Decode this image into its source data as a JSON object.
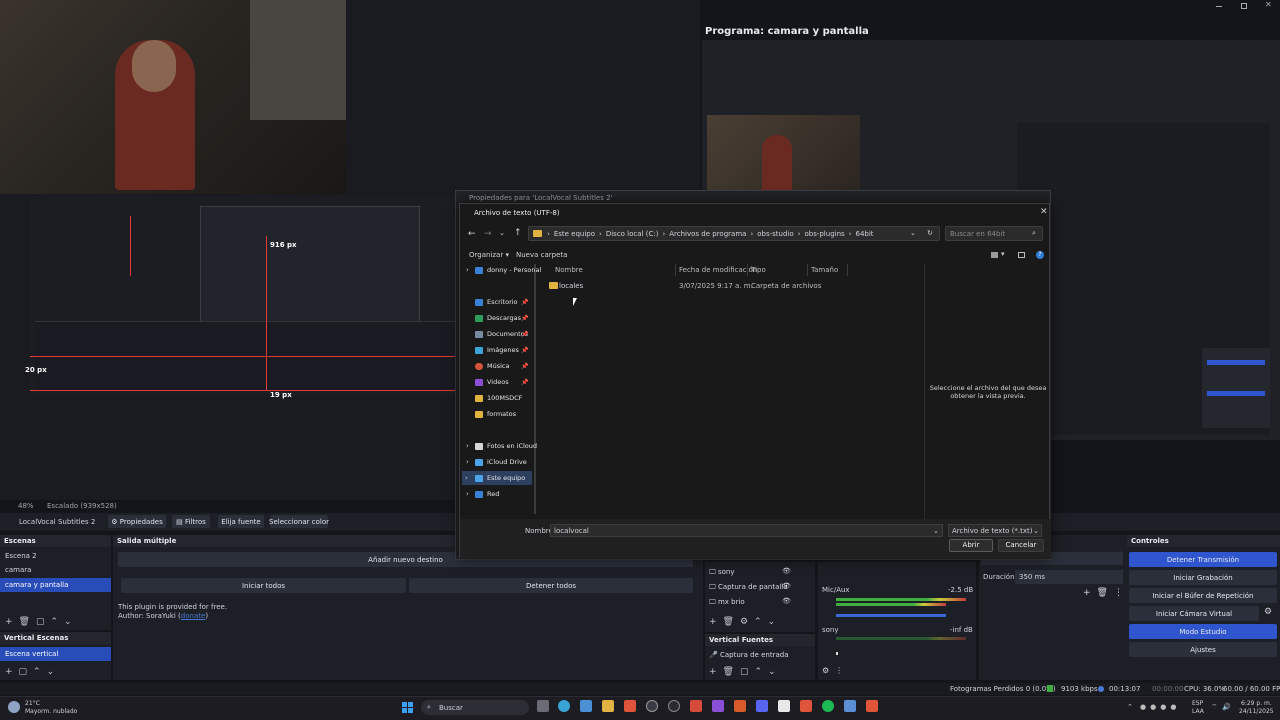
{
  "window": {
    "program_title": "Programa: camara y pantalla",
    "window_controls": [
      "minimize",
      "maximize",
      "close"
    ]
  },
  "preview": {
    "zoom": "48%",
    "scaling": "Escalado (939x528)",
    "measure_labels": [
      "916 px",
      "20 px",
      "19 px"
    ]
  },
  "source_toolbar": {
    "source_name": "LocalVocal Subtitles 2",
    "buttons": [
      "Propiedades",
      "Filtros",
      "Elija fuente",
      "Seleccionar color"
    ]
  },
  "properties_window": {
    "title": "Propiedades para 'LocalVocal Subtitles 2'"
  },
  "file_dialog": {
    "title": "Archivo de texto (UTF-8)",
    "breadcrumb": [
      "Este equipo",
      "Disco local (C:)",
      "Archivos de programa",
      "obs-studio",
      "obs-plugins",
      "64bit"
    ],
    "search_placeholder": "Buscar en 64bit",
    "organize_label": "Organizar",
    "new_folder_label": "Nueva carpeta",
    "columns": [
      "Nombre",
      "Fecha de modificación",
      "Tipo",
      "Tamaño"
    ],
    "files": [
      {
        "name": "locales",
        "modified": "3/07/2025 9:17 a. m.",
        "type": "Carpeta de archivos",
        "size": ""
      }
    ],
    "sidebar": [
      {
        "label": "donny - Personal",
        "icon": "cloud-icon",
        "pinned": false
      },
      {
        "label": "Escritorio",
        "icon": "desktop-icon",
        "pinned": true
      },
      {
        "label": "Descargas",
        "icon": "download-icon",
        "pinned": true
      },
      {
        "label": "Documentos",
        "icon": "document-icon",
        "pinned": true
      },
      {
        "label": "Imágenes",
        "icon": "image-icon",
        "pinned": true
      },
      {
        "label": "Música",
        "icon": "music-icon",
        "pinned": true
      },
      {
        "label": "Videos",
        "icon": "video-icon",
        "pinned": true
      },
      {
        "label": "100MSDCF",
        "icon": "folder-icon",
        "pinned": false
      },
      {
        "label": "formatos",
        "icon": "folder-icon",
        "pinned": false
      },
      {
        "label": "Fotos en iCloud",
        "icon": "photos-icon",
        "pinned": false
      },
      {
        "label": "iCloud Drive",
        "icon": "icloud-icon",
        "pinned": false
      },
      {
        "label": "Este equipo",
        "icon": "pc-icon",
        "pinned": false
      },
      {
        "label": "Red",
        "icon": "network-icon",
        "pinned": false
      }
    ],
    "preview_message": "Seleccione el archivo del que desea obtener la vista previa.",
    "filename_label": "Nombre:",
    "filename_value": "localvocal",
    "filetype_value": "Archivo de texto (*.txt)",
    "open_label": "Abrir",
    "cancel_label": "Cancelar"
  },
  "scenes": {
    "header": "Escenas",
    "items": [
      "Escena 2",
      "camara",
      "camara y pantalla"
    ],
    "selected": 2
  },
  "vertical_scenes": {
    "header": "Vertical Escenas",
    "items": [
      "Escena vertical"
    ]
  },
  "multi_output": {
    "header": "Salida múltiple",
    "add_destination": "Añadir nuevo destino",
    "start_all": "Iniciar todos",
    "stop_all": "Detener todos",
    "info_line1": "This plugin is provided for free.",
    "info_line2_prefix": "Author: SoraYuki (",
    "info_link": "donate",
    "info_line2_suffix": ")"
  },
  "sources": {
    "items": [
      "sony",
      "Captura de pantalla",
      "mx brio"
    ]
  },
  "vertical_sources": {
    "header": "Vertical Fuentes",
    "items": [
      "Captura de entrada"
    ]
  },
  "audio_mixer": {
    "channels": [
      {
        "name": "Mic/Aux",
        "db": "-2.5 dB"
      },
      {
        "name": "sony",
        "db": "-inf dB"
      }
    ],
    "scale": [
      "-60",
      "-55",
      "-50",
      "-45",
      "-40",
      "-35",
      "-30",
      "-25",
      "-20",
      "-15",
      "-10",
      "-5",
      "0"
    ]
  },
  "transitions": {
    "header": "...na",
    "duration_label": "Duración",
    "duration_value": "350 ms"
  },
  "controls": {
    "header": "Controles",
    "buttons": [
      "Detener Transmisión",
      "Iniciar Grabación",
      "Iniciar el Búfer de Repetición",
      "Iniciar Cámara Virtual",
      "Modo Estudio",
      "Ajustes"
    ]
  },
  "status_bar": {
    "dropped_frames": "Fotogramas Perdidos 0 (0.0%)",
    "bitrate": "9103 kbps",
    "stream_time": "00:13:07",
    "rec_time": "00:00:00",
    "cpu": "CPU: 36.0%",
    "fps": "60.00 / 60.00 FPS"
  },
  "taskbar": {
    "weather_temp": "21°C",
    "weather_desc": "Mayorm. nublado",
    "search_placeholder": "Buscar",
    "lang": "ESP",
    "lang_sub": "LAA",
    "time": "6:29 p. m.",
    "date": "24/11/2025"
  },
  "colors": {
    "accent": "#284cb8",
    "control_blue": "#2f55cf",
    "dialog_bg": "#191919",
    "obs_bg": "#1d1f26"
  }
}
